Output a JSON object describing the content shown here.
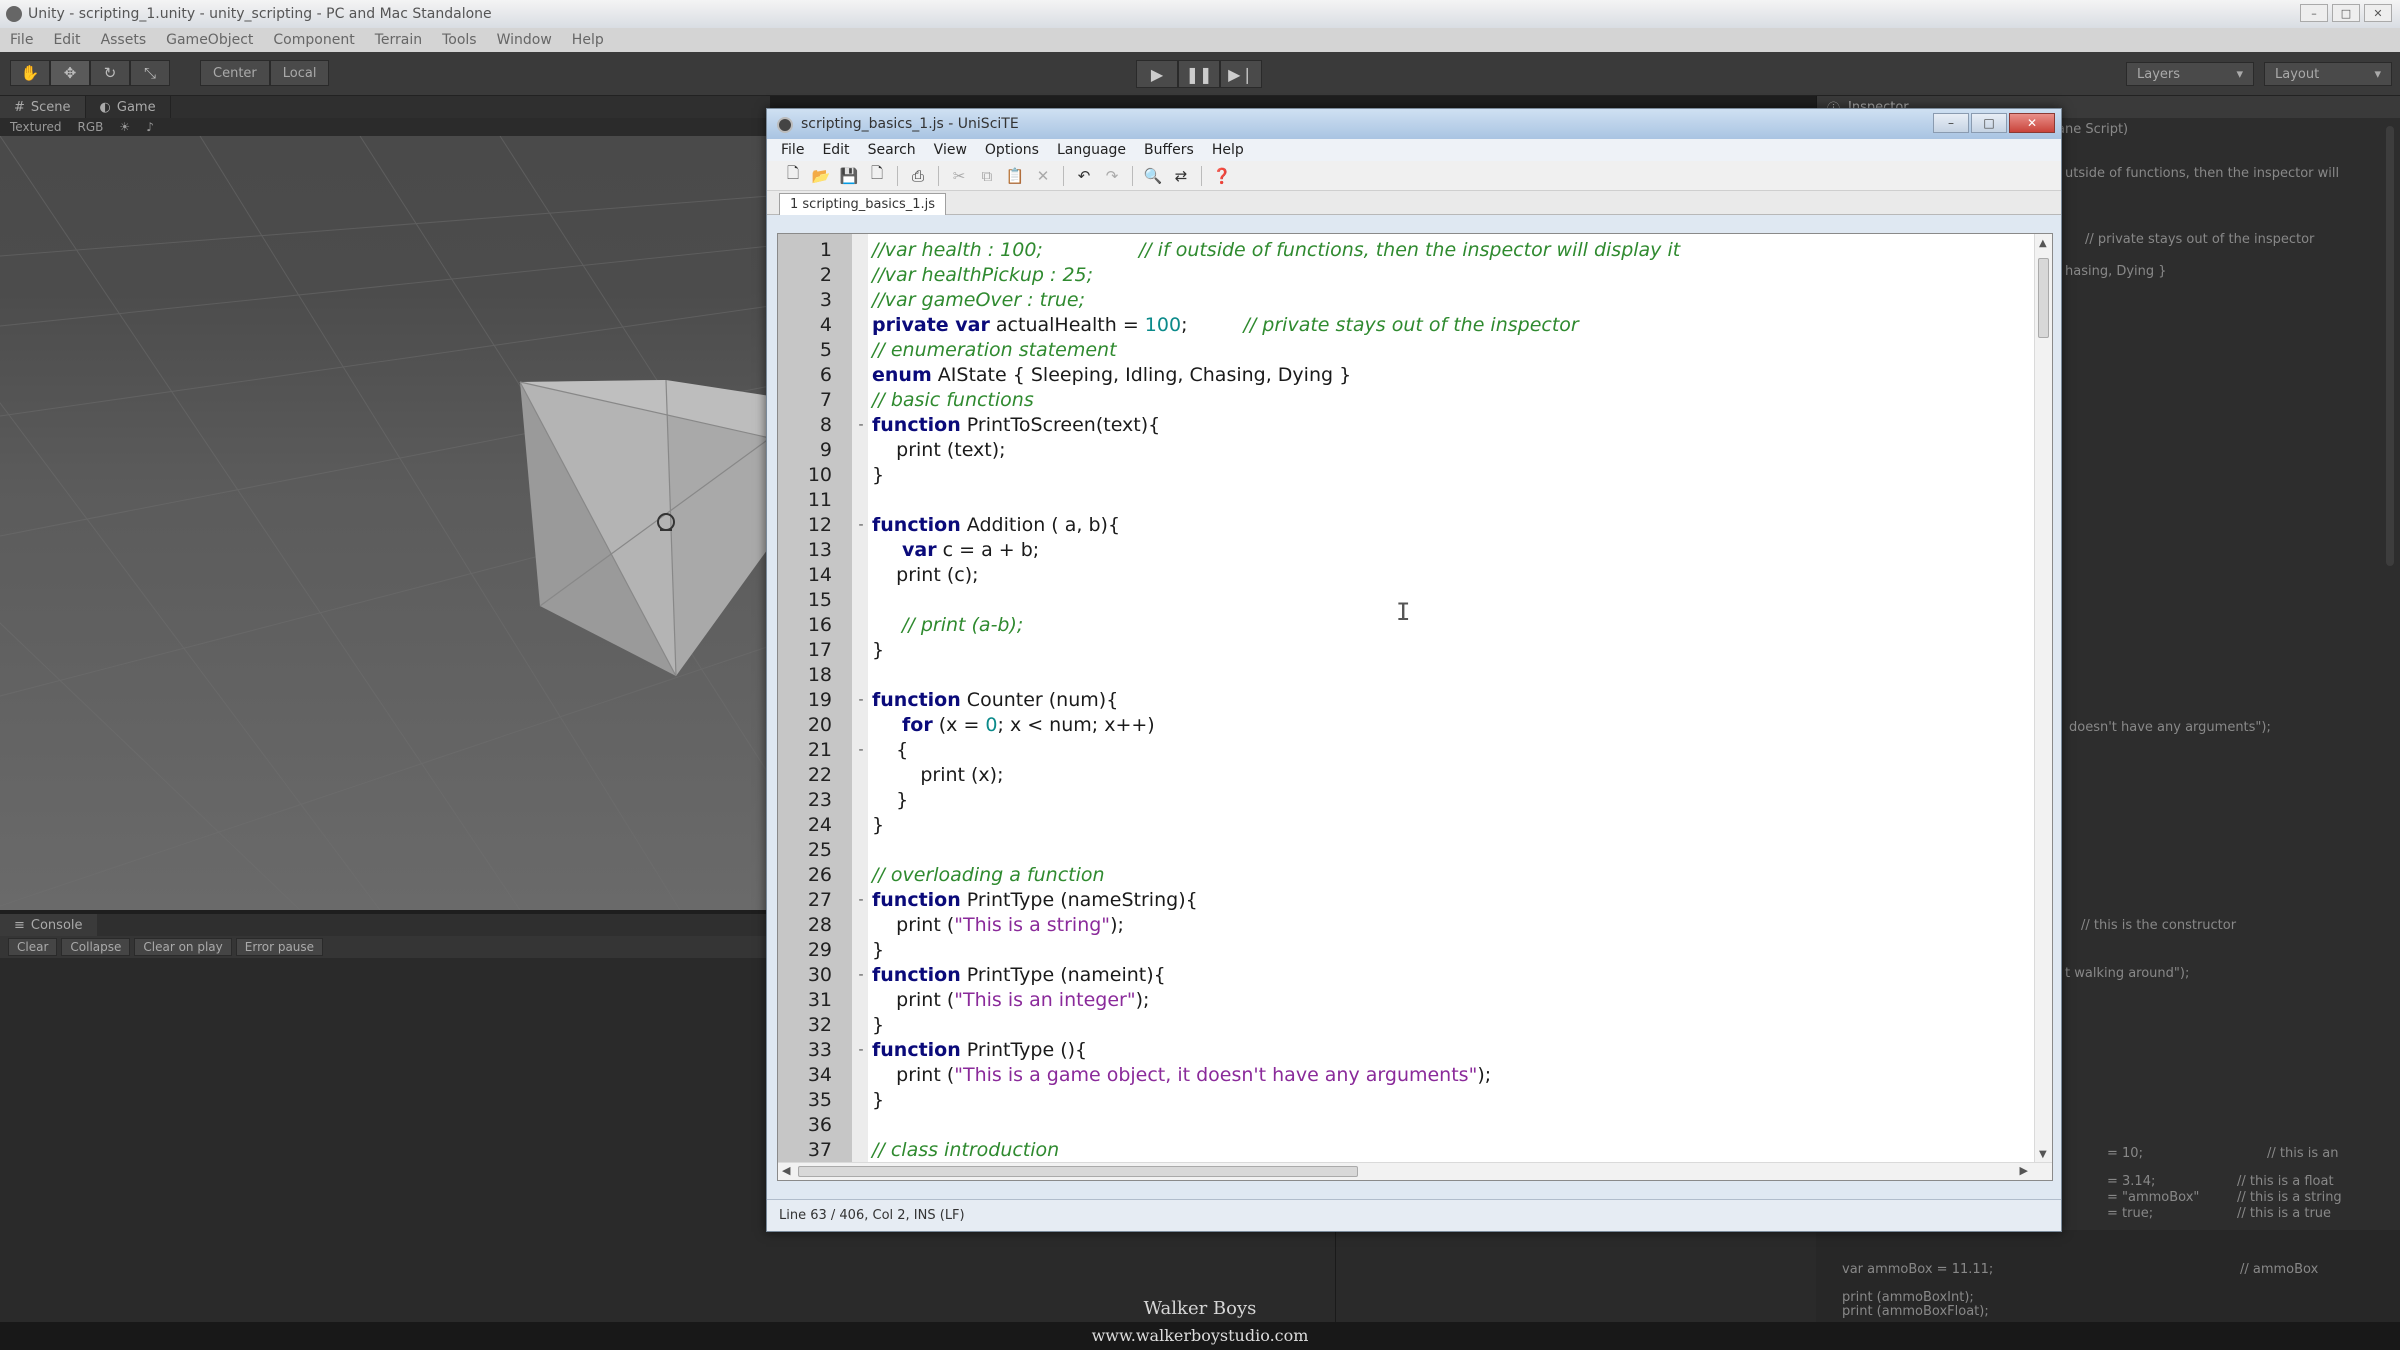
{
  "unity": {
    "title": "Unity - scripting_1.unity - unity_scripting - PC and Mac Standalone",
    "menu": [
      "File",
      "Edit",
      "Assets",
      "GameObject",
      "Component",
      "Terrain",
      "Tools",
      "Window",
      "Help"
    ],
    "pivot": "Center",
    "space": "Local",
    "layers": "Layers",
    "layout": "Layout",
    "scene_tab": "Scene",
    "game_tab": "Game",
    "shading": "Textured",
    "mode": "RGB",
    "console_tab": "Console",
    "console_buttons": [
      "Clear",
      "Collapse",
      "Clear on play",
      "Error pause"
    ]
  },
  "editor": {
    "title": "scripting_basics_1.js - UniSciTE",
    "menu": [
      "File",
      "Edit",
      "Search",
      "View",
      "Options",
      "Language",
      "Buffers",
      "Help"
    ],
    "tab": "1 scripting_basics_1.js",
    "status": "Line 63 / 406, Col 2, INS (LF)",
    "lines": [
      {
        "n": "1"
      },
      {
        "n": "2"
      },
      {
        "n": "3"
      },
      {
        "n": "4"
      },
      {
        "n": "5"
      },
      {
        "n": "6"
      },
      {
        "n": "7"
      },
      {
        "n": "8",
        "fold": "-"
      },
      {
        "n": "9"
      },
      {
        "n": "10"
      },
      {
        "n": "11"
      },
      {
        "n": "12",
        "fold": "-"
      },
      {
        "n": "13"
      },
      {
        "n": "14"
      },
      {
        "n": "15"
      },
      {
        "n": "16"
      },
      {
        "n": "17"
      },
      {
        "n": "18"
      },
      {
        "n": "19",
        "fold": "-"
      },
      {
        "n": "20"
      },
      {
        "n": "21",
        "fold": "-"
      },
      {
        "n": "22"
      },
      {
        "n": "23"
      },
      {
        "n": "24"
      },
      {
        "n": "25"
      },
      {
        "n": "26"
      },
      {
        "n": "27",
        "fold": "-"
      },
      {
        "n": "28"
      },
      {
        "n": "29"
      },
      {
        "n": "30",
        "fold": "-"
      },
      {
        "n": "31"
      },
      {
        "n": "32"
      },
      {
        "n": "33",
        "fold": "-"
      },
      {
        "n": "34"
      },
      {
        "n": "35"
      },
      {
        "n": "36"
      },
      {
        "n": "37"
      }
    ],
    "code": {
      "l1": "//var health : 100;",
      "l1c": "// if outside of functions, then the inspector will display it",
      "l2": "//var healthPickup : 25;",
      "l3": "//var gameOver : true;",
      "l4k": "private var",
      "l4a": " actualHealth = ",
      "l4n": "100",
      "l4b": ";",
      "l4c": "// private stays out of the inspector",
      "l5": "// enumeration statement",
      "l6k": "enum",
      "l6a": " AIState { Sleeping, Idling, Chasing, Dying }",
      "l7": "// basic functions",
      "l8k": "function",
      "l8a": " PrintToScreen(text){",
      "l9": "    print (text);",
      "l10": "}",
      "l12k": "function",
      "l12a": " Addition ( a, b){",
      "l13k": "var",
      "l13a": " c = a + b;",
      "l14": "    print (c);",
      "l16": "// print (a-b);",
      "l17": "}",
      "l19k": "function",
      "l19a": " Counter (num){",
      "l20k": "for",
      "l20a": " (x = ",
      "l20n": "0",
      "l20b": "; x < num; x++)",
      "l21": "    {",
      "l22": "        print (x);",
      "l23": "    }",
      "l24": "}",
      "l26": "// overloading a function",
      "l27k": "function",
      "l27a": " PrintType (nameString){",
      "l28a": "    print (",
      "l28s": "\"This is a string\"",
      "l28b": ");",
      "l29": "}",
      "l30k": "function",
      "l30a": " PrintType (nameint){",
      "l31a": "    print (",
      "l31s": "\"This is an integer\"",
      "l31b": ");",
      "l32": "}",
      "l33k": "function",
      "l33a": " PrintType (){",
      "l34a": "    print (",
      "l34s": "\"This is a game object, it doesn't have any arguments\"",
      "l34b": ");",
      "l35": "}",
      "l37": "// class introduction"
    }
  },
  "inspector": {
    "tab": "Inspector",
    "header": "ane Script)",
    "lines": [
      "utside of functions, then the inspector will",
      "// private stays out of the inspector",
      "hasing, Dying }",
      "doesn't have any arguments\");",
      "// this is the constructor",
      "t walking around\");",
      "= 10;",
      "// this is an",
      "= 3.14;",
      "// this is a float",
      "= \"ammoBox\"",
      "// this is a string",
      "= true;",
      "// this is a true",
      "var ammoBox = 11.11;",
      "// ammoBox",
      "print (ammoBoxInt);",
      "print (ammoBoxFloat);"
    ]
  },
  "watermark": {
    "name": "Walker Boys",
    "url": "www.walkerboystudio.com"
  }
}
